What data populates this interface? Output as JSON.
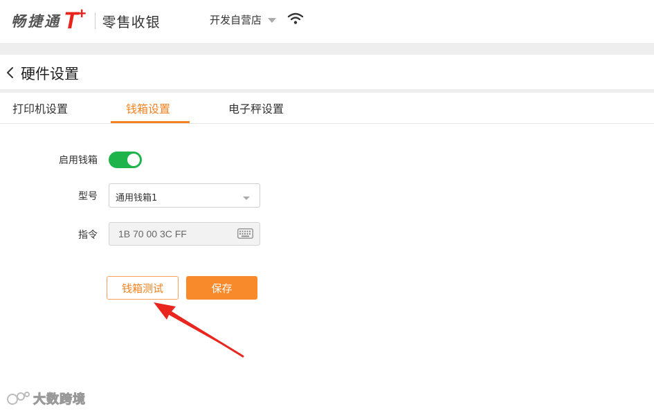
{
  "header": {
    "brand_name": "畅捷通",
    "brand_t": "T",
    "brand_plus": "+",
    "product_name": "零售收银",
    "store_name": "开发自营店"
  },
  "page": {
    "title": "硬件设置"
  },
  "tabs": [
    {
      "label": "打印机设置",
      "active": false
    },
    {
      "label": "钱箱设置",
      "active": true
    },
    {
      "label": "电子秤设置",
      "active": false
    }
  ],
  "form": {
    "enable_label": "启用钱箱",
    "enable_on": true,
    "model_label": "型号",
    "model_value": "通用钱箱1",
    "command_label": "指令",
    "command_value": "1B 70 00 3C FF"
  },
  "buttons": {
    "test_label": "钱箱测试",
    "save_label": "保存"
  },
  "watermark": {
    "text": "大数跨境"
  },
  "colors": {
    "accent": "#f5821f",
    "brand_red": "#e8231b",
    "toggle_on": "#1fb44b",
    "annotation_arrow": "#e8261f"
  }
}
